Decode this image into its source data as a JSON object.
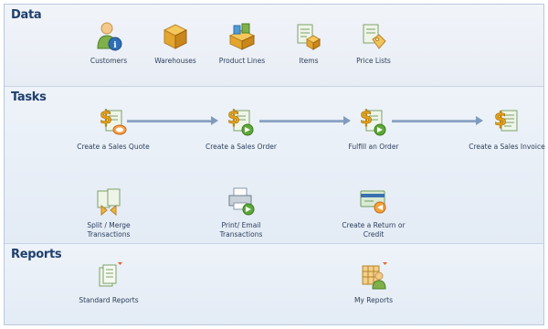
{
  "sections": {
    "data": {
      "title": "Data",
      "items": [
        {
          "label": "Customers",
          "icon": "customer-icon"
        },
        {
          "label": "Warehouses",
          "icon": "warehouse-icon"
        },
        {
          "label": "Product Lines",
          "icon": "product-lines-icon"
        },
        {
          "label": "Items",
          "icon": "items-icon"
        },
        {
          "label": "Price Lists",
          "icon": "price-list-icon"
        }
      ]
    },
    "tasks": {
      "title": "Tasks",
      "flow": [
        {
          "label": "Create a Sales Quote",
          "icon": "sales-quote-icon"
        },
        {
          "label": "Create a Sales Order",
          "icon": "sales-order-icon"
        },
        {
          "label": "Fulfill an Order",
          "icon": "fulfill-order-icon"
        },
        {
          "label": "Create a Sales Invoice",
          "icon": "sales-invoice-icon"
        }
      ],
      "other": [
        {
          "label_line1": "Split / Merge",
          "label_line2": "Transactions",
          "icon": "split-merge-icon"
        },
        {
          "label_line1": "Print/ Email",
          "label_line2": "Transactions",
          "icon": "print-email-icon"
        },
        {
          "label_line1": "Create a Return or",
          "label_line2": "Credit",
          "icon": "return-credit-icon"
        }
      ]
    },
    "reports": {
      "title": "Reports",
      "items": [
        {
          "label": "Standard Reports",
          "icon": "standard-reports-icon"
        },
        {
          "label": "My Reports",
          "icon": "my-reports-icon"
        }
      ]
    }
  },
  "colors": {
    "title": "#1f3f6e",
    "label": "#2b3f5c",
    "arrow": "#7f9bbd",
    "dollar": "#e3a21a"
  }
}
